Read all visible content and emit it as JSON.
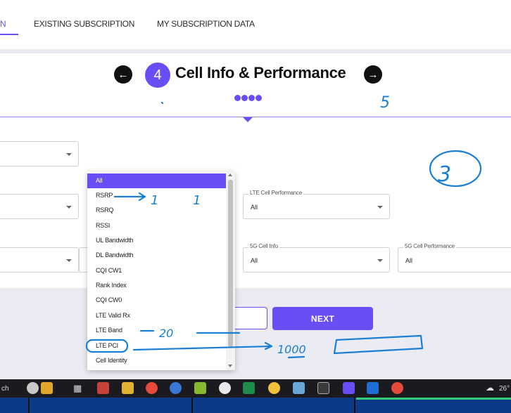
{
  "nav": {
    "tabs": [
      {
        "label": "N"
      },
      {
        "label": "EXISTING SUBSCRIPTION"
      },
      {
        "label": "MY SUBSCRIPTION DATA"
      }
    ]
  },
  "step": {
    "number": "4",
    "title": "Cell Info & Performance",
    "prev_icon": "arrow-left-icon",
    "next_icon": "arrow-right-icon"
  },
  "fields": {
    "lte_cell_performance": {
      "label": "LTE Cell Performance",
      "value": "All"
    },
    "fiveg_cell_info": {
      "label": "5G Cell Info",
      "value": "All"
    },
    "fiveg_cell_performance": {
      "label": "5G Cell Performance",
      "value": "All"
    }
  },
  "dropdown": {
    "options": [
      "All",
      "RSRP",
      "RSRQ",
      "RSSI",
      "UL Bandwidth",
      "DL Bandwidth",
      "CQI CW1",
      "Rank Index",
      "CQI CW0",
      "LTE Valid Rx",
      "LTE Band",
      "LTE PCI",
      "Cell Identity"
    ],
    "selected": "All"
  },
  "buttons": {
    "next_label": "NEXT"
  },
  "annotations": {
    "five": "5",
    "three": "3",
    "one_a": "1",
    "one_b": "1",
    "twenty": "20",
    "thousand": "1000"
  },
  "taskbar": {
    "left_text": "ch",
    "temp": "26°"
  },
  "colors": {
    "accent": "#6a4df4",
    "pen": "#1a7fd4",
    "taskbar": "#1b1b1f"
  }
}
